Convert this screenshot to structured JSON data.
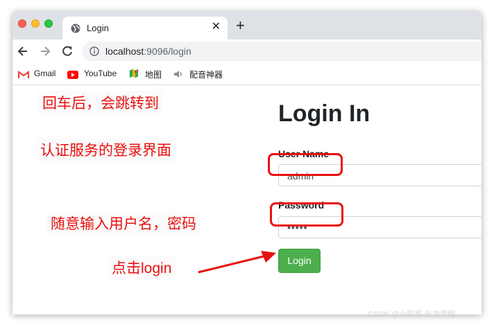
{
  "browser": {
    "tab_title": "Login",
    "new_tab": "+",
    "tab_close": "✕",
    "url_host": "localhost",
    "url_rest": ":9096/login"
  },
  "bookmarks": [
    {
      "label": "Gmail",
      "icon": "gmail-icon"
    },
    {
      "label": "YouTube",
      "icon": "youtube-icon"
    },
    {
      "label": "地图",
      "icon": "maps-icon"
    },
    {
      "label": "配音神器",
      "icon": "speaker-icon"
    }
  ],
  "login": {
    "title": "Login In",
    "username_label": "User Name",
    "username_value": "admin",
    "password_label": "Password",
    "password_value": "•••••",
    "button_label": "Login"
  },
  "annotations": {
    "line1": "回车后，会跳转到",
    "line2": "认证服务的登录界面",
    "line3": "随意输入用户名，密码",
    "line4": "点击login"
  },
  "watermark": "CSDN @小码哥·张波课程",
  "colors": {
    "annotation_red": "#e8110f",
    "button_green": "#4cae4c"
  }
}
